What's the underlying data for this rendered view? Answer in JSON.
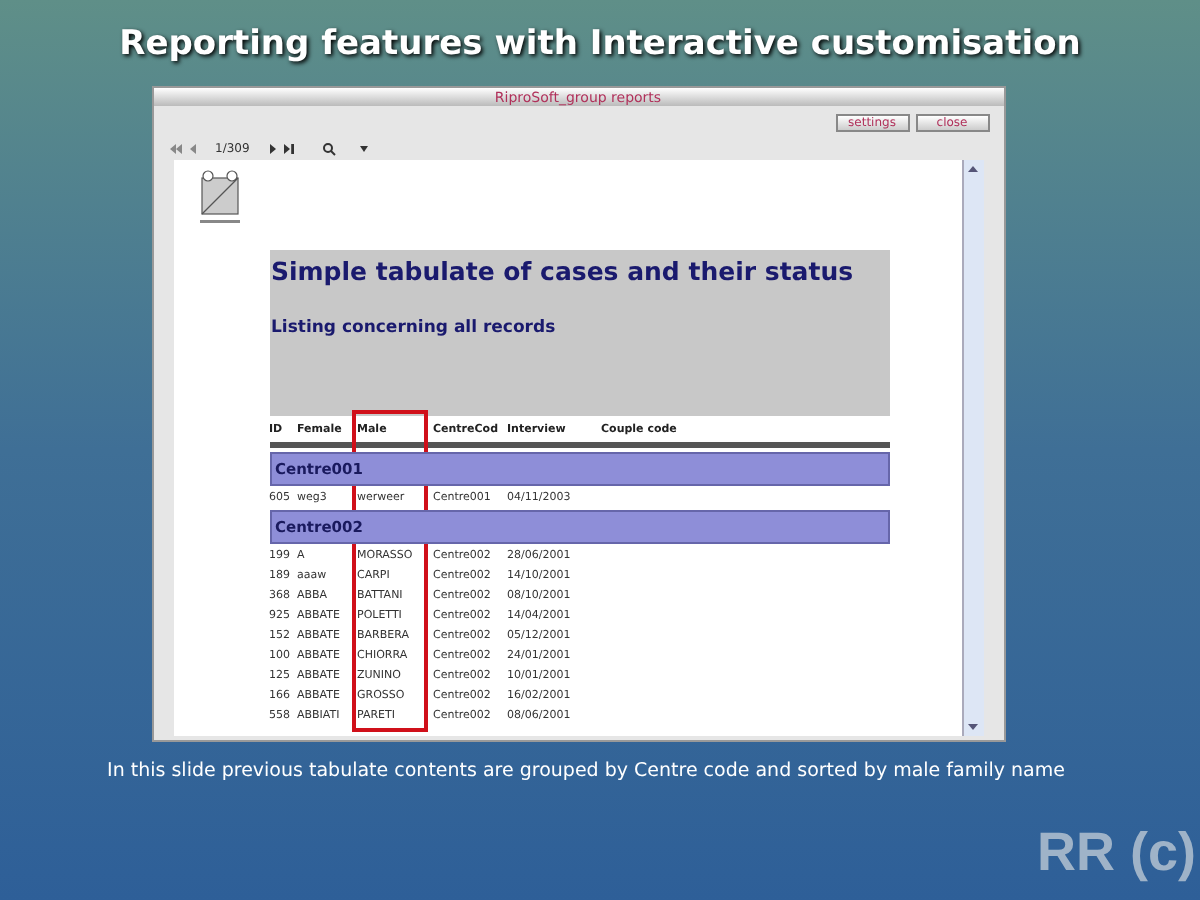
{
  "slide_title": "Reporting features with Interactive customisation",
  "window": {
    "title": "RiproSoft_group reports",
    "buttons": [
      "settings",
      "close"
    ],
    "page_indicator": "1/309"
  },
  "report": {
    "title": "Simple tabulate of cases and their status",
    "subtitle": "Listing concerning all records",
    "columns": [
      "ID",
      "Female",
      "Male",
      "CentreCod",
      "Interview",
      "Couple code"
    ],
    "groups": [
      {
        "name": "Centre001",
        "rows": [
          [
            "605",
            "weg3",
            "werweer",
            "Centre001",
            "04/11/2003"
          ]
        ]
      },
      {
        "name": "Centre002",
        "rows": [
          [
            "199",
            "A",
            "MORASSO",
            "Centre002",
            "28/06/2001"
          ],
          [
            "189",
            "aaaw",
            "CARPI",
            "Centre002",
            "14/10/2001"
          ],
          [
            "368",
            "ABBA",
            "BATTANI",
            "Centre002",
            "08/10/2001"
          ],
          [
            "925",
            "ABBATE",
            "POLETTI",
            "Centre002",
            "14/04/2001"
          ],
          [
            "152",
            "ABBATE",
            "BARBERA",
            "Centre002",
            "05/12/2001"
          ],
          [
            "100",
            "ABBATE",
            "CHIORRA",
            "Centre002",
            "24/01/2001"
          ],
          [
            "125",
            "ABBATE",
            "ZUNINO",
            "Centre002",
            "10/01/2001"
          ],
          [
            "166",
            "ABBATE",
            "GROSSO",
            "Centre002",
            "16/02/2001"
          ],
          [
            "558",
            "ABBIATI",
            "PARETI",
            "Centre002",
            "08/06/2001"
          ]
        ]
      }
    ]
  },
  "caption": "In this slide previous tabulate contents are grouped by Centre code and sorted by male family name",
  "author_mark": "RR (c)"
}
